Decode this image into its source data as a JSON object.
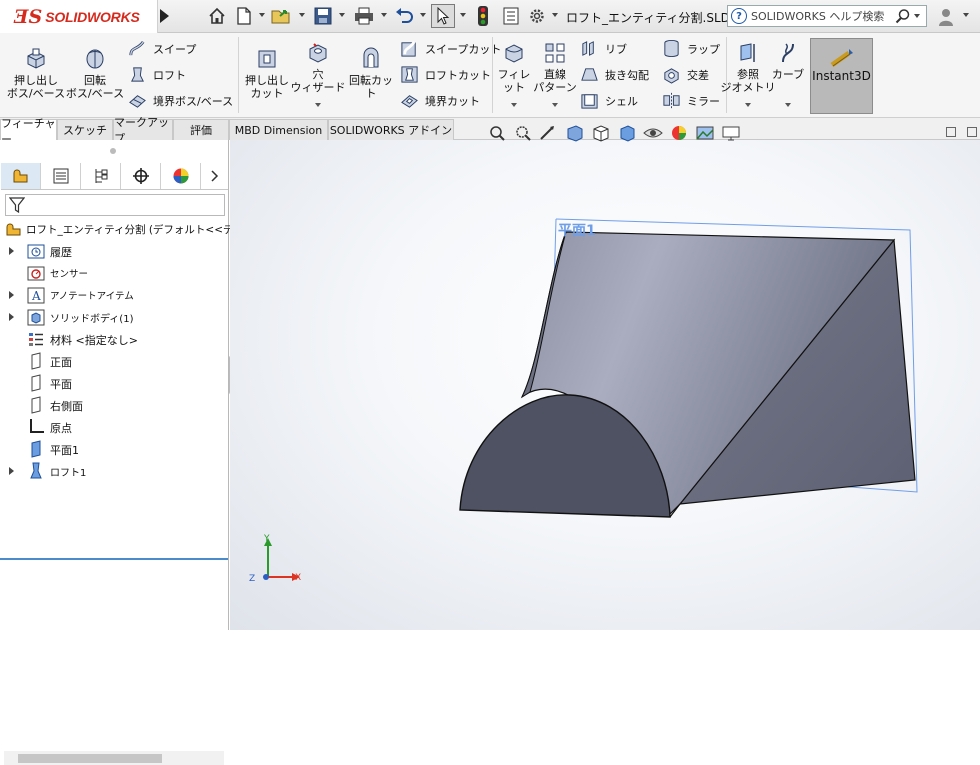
{
  "app": {
    "logo_text": "SOLIDWORKS",
    "document_title": "ロフト_エンティティ分割.SLDP...",
    "help_search_placeholder": "SOLIDWORKS ヘルプ検索"
  },
  "ribbon": {
    "extrude_boss": "押し出し\nボス/ベース",
    "revolve_boss": "回転\nボス/ベース",
    "sweep": "スイープ",
    "loft": "ロフト",
    "boundary_boss": "境界ボス/ベース",
    "extrude_cut": "押し出し\nカット",
    "hole_wizard": "穴\nウィザード",
    "revolve_cut": "回転カット",
    "sweep_cut": "スイープカット",
    "loft_cut": "ロフトカット",
    "boundary_cut": "境界カット",
    "fillet": "フィレット",
    "linear_pattern": "直線\nパターン",
    "rib": "リブ",
    "draft": "抜き勾配",
    "shell": "シェル",
    "wrap": "ラップ",
    "intersect": "交差",
    "mirror": "ミラー",
    "ref_geometry": "参照\nジオメトリ",
    "curves": "カーブ",
    "instant3d": "Instant3D"
  },
  "tabs": [
    {
      "label": "フィーチャー",
      "active": true
    },
    {
      "label": "スケッチ",
      "active": false
    },
    {
      "label": "マークアップ",
      "active": false
    },
    {
      "label": "評価",
      "active": false
    },
    {
      "label": "MBD Dimension",
      "active": false
    },
    {
      "label": "SOLIDWORKS アドイン",
      "active": false
    }
  ],
  "tree": {
    "root": "ロフト_エンティティ分割 (デフォルト<<デフォルト",
    "items": [
      {
        "label": "履歴",
        "expandable": true,
        "icon": "history-folder-icon"
      },
      {
        "label": "センサー",
        "expandable": false,
        "icon": "sensor-icon"
      },
      {
        "label": "アノテートアイテム",
        "expandable": true,
        "icon": "annotation-icon"
      },
      {
        "label": "ソリッドボディ(1)",
        "expandable": true,
        "icon": "solid-body-icon"
      },
      {
        "label": "材料 <指定なし>",
        "expandable": false,
        "icon": "material-icon"
      },
      {
        "label": "正面",
        "expandable": false,
        "icon": "plane-icon"
      },
      {
        "label": "平面",
        "expandable": false,
        "icon": "plane-icon"
      },
      {
        "label": "右側面",
        "expandable": false,
        "icon": "plane-icon"
      },
      {
        "label": "原点",
        "expandable": false,
        "icon": "origin-icon"
      },
      {
        "label": "平面1",
        "expandable": false,
        "icon": "plane-blue-icon"
      },
      {
        "label": "ロフト1",
        "expandable": true,
        "icon": "loft-feature-icon"
      }
    ]
  },
  "viewport": {
    "plane_label": "平面1",
    "triad": {
      "x": "X",
      "y": "Y",
      "z": "Z"
    }
  },
  "colors": {
    "brand_red": "#d52b1e",
    "plane_blue": "#6f9ee8",
    "part_gray": "#6a6e7e"
  }
}
